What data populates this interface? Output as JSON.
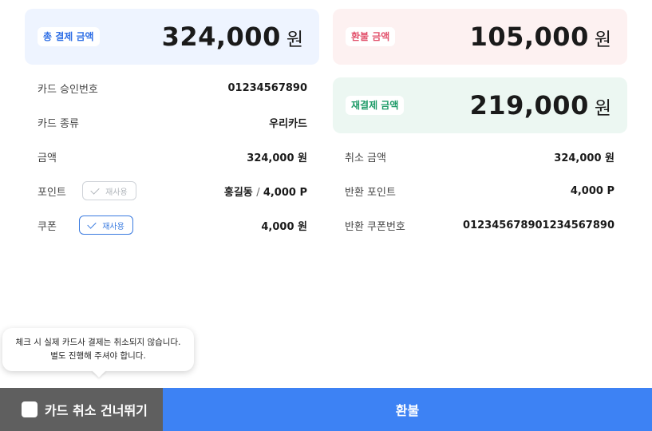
{
  "summary": {
    "total": {
      "badge": "총 결제 금액",
      "amount": "324,000",
      "unit": "원"
    },
    "refund": {
      "badge": "환불 금액",
      "amount": "105,000",
      "unit": "원"
    },
    "repay": {
      "badge": "재결제 금액",
      "amount": "219,000",
      "unit": "원"
    }
  },
  "payment_details": {
    "approval_no": {
      "label": "카드 승인번호",
      "value": "01234567890"
    },
    "card_type": {
      "label": "카드 종류",
      "value": "우리카드"
    },
    "amount": {
      "label": "금액",
      "value": "324,000 원"
    },
    "points": {
      "label": "포인트",
      "reuse_label": "재사용",
      "reuse_checked": false,
      "holder": "홍길동",
      "separator": "/",
      "value": "4,000 P"
    },
    "coupon": {
      "label": "쿠폰",
      "reuse_label": "재사용",
      "reuse_checked": true,
      "value": "4,000 원"
    }
  },
  "refund_details": {
    "cancel_amount": {
      "label": "취소 금액",
      "value": "324,000 원"
    },
    "return_points": {
      "label": "반환 포인트",
      "value": "4,000 P"
    },
    "return_coupon_no": {
      "label": "반환 쿠폰번호",
      "value": "012345678901234567890"
    }
  },
  "tooltip": {
    "line1": "체크 시 실제 카드사 결제는 취소되지 않습니다.",
    "line2": "별도 진행해 주셔야 합니다."
  },
  "footer": {
    "skip_label": "카드 취소 건너뛰기",
    "skip_checked": false,
    "refund_button": "환불"
  },
  "colors": {
    "total_accent": "#2f6fe6",
    "refund_accent": "#e2506b",
    "repay_accent": "#1e9b68",
    "primary_button": "#3d82f4",
    "skip_bar": "#5f5f5f"
  }
}
